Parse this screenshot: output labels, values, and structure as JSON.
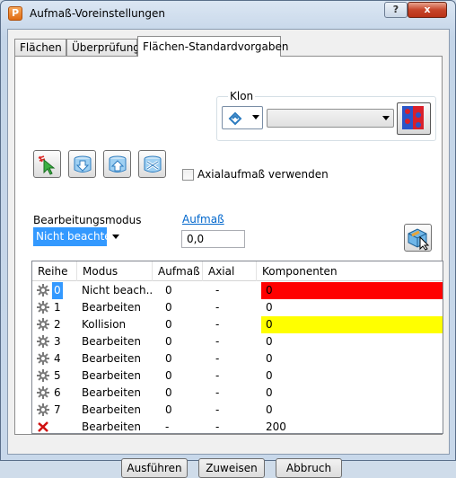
{
  "window": {
    "title": "Aufmaß-Voreinstellungen",
    "app_icon_letter": "P",
    "help_label": "?",
    "close_label": "x"
  },
  "tabs": [
    {
      "label": "Flächen",
      "active": false
    },
    {
      "label": "Überprüfung",
      "active": false
    },
    {
      "label": "Flächen-Standardvorgaben",
      "active": true
    }
  ],
  "klon": {
    "label": "Klon",
    "icon": "clone-icon",
    "select_value": ""
  },
  "toolbar": {
    "buttons": [
      "select-surfaces-icon",
      "arrow-down-icon",
      "arrow-up-icon",
      "clear-icon"
    ]
  },
  "axial_checkbox": {
    "label": "Axialaufmaß verwenden",
    "checked": false
  },
  "bearbeitungsmodus": {
    "label": "Bearbeitungsmodus",
    "value": "Nicht beachten"
  },
  "aufmass": {
    "link_label": "Aufmaß",
    "value": "0,0"
  },
  "table": {
    "headers": [
      "Reihe",
      "Modus",
      "Aufmaß",
      "Axial",
      "Komponenten"
    ],
    "rows": [
      {
        "reihe": "0",
        "modus": "Nicht beach...",
        "aufmass": "0",
        "axial": "-",
        "komponenten": "0",
        "color": "#ff0000",
        "icon": "gear-icon",
        "selected": true
      },
      {
        "reihe": "1",
        "modus": "Bearbeiten",
        "aufmass": "0",
        "axial": "-",
        "komponenten": "0",
        "color": "",
        "icon": "gear-icon",
        "selected": false
      },
      {
        "reihe": "2",
        "modus": "Kollision",
        "aufmass": "0",
        "axial": "-",
        "komponenten": "0",
        "color": "#ffff00",
        "icon": "gear-icon",
        "selected": false
      },
      {
        "reihe": "3",
        "modus": "Bearbeiten",
        "aufmass": "0",
        "axial": "-",
        "komponenten": "0",
        "color": "",
        "icon": "gear-icon",
        "selected": false
      },
      {
        "reihe": "4",
        "modus": "Bearbeiten",
        "aufmass": "0",
        "axial": "-",
        "komponenten": "0",
        "color": "",
        "icon": "gear-icon",
        "selected": false
      },
      {
        "reihe": "5",
        "modus": "Bearbeiten",
        "aufmass": "0",
        "axial": "-",
        "komponenten": "0",
        "color": "",
        "icon": "gear-icon",
        "selected": false
      },
      {
        "reihe": "6",
        "modus": "Bearbeiten",
        "aufmass": "0",
        "axial": "-",
        "komponenten": "0",
        "color": "",
        "icon": "gear-icon",
        "selected": false
      },
      {
        "reihe": "7",
        "modus": "Bearbeiten",
        "aufmass": "0",
        "axial": "-",
        "komponenten": "0",
        "color": "",
        "icon": "gear-icon",
        "selected": false
      },
      {
        "reihe": "",
        "modus": "Bearbeiten",
        "aufmass": "-",
        "axial": "-",
        "komponenten": "200",
        "color": "",
        "icon": "red-x-icon",
        "selected": false
      }
    ]
  },
  "footer": {
    "apply_label": "Ausführen",
    "assign_label": "Zuweisen",
    "cancel_label": "Abbruch"
  }
}
